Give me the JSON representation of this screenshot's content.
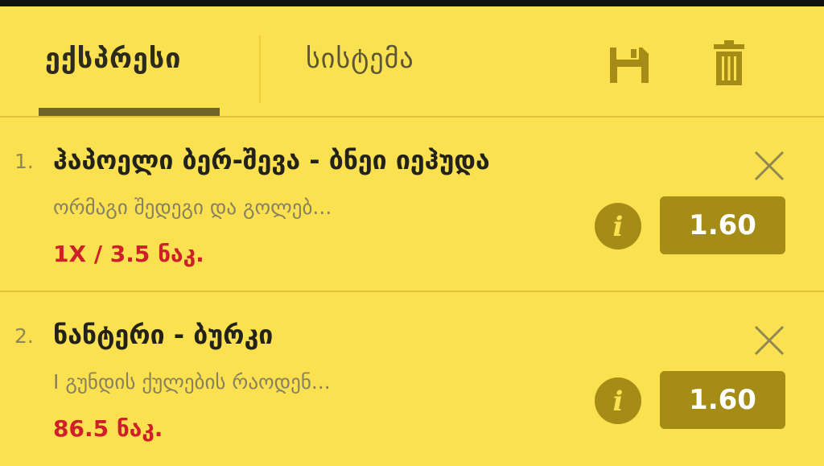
{
  "tabs": [
    {
      "label": "ექსპრესი",
      "active": true
    },
    {
      "label": "სისტემა",
      "active": false
    }
  ],
  "toolbar": {
    "save_icon": "save-icon",
    "delete_icon": "trash-icon"
  },
  "bets": [
    {
      "number": "1.",
      "title": "ჰაპოელი ბერ-შევა - ბნეი იეჰუდა",
      "subtitle": "ორმაგი შედეგი და გოლებ...",
      "pick": "1X / 3.5 ნაკ.",
      "odds": "1.60"
    },
    {
      "number": "2.",
      "title": "ნანტერი - ბურკი",
      "subtitle": "I გუნდის ქულების რაოდენ...",
      "pick": "86.5 ნაკ.",
      "odds": "1.60"
    }
  ],
  "colors": {
    "background": "#fbe04f",
    "accent": "#a48c17",
    "pick": "#cf1f2a",
    "active_underline": "#6f6325"
  }
}
